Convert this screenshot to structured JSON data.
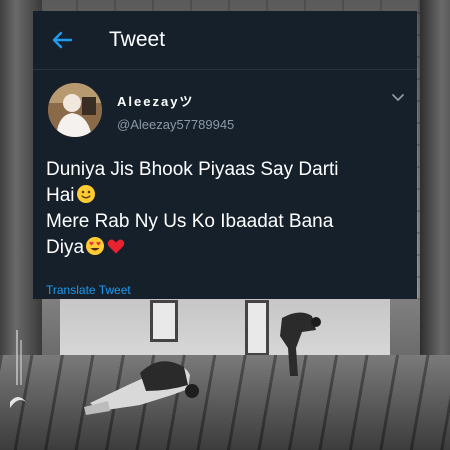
{
  "header": {
    "title": "Tweet"
  },
  "author": {
    "name": "Aleezayツ",
    "handle": "@Aleezay57789945"
  },
  "tweet": {
    "line1": "Duniya Jis Bhook Piyaas Say Darti",
    "line2": "Hai",
    "line3": "Mere Rab Ny Us Ko Ibaadat Bana",
    "line4": "Diya"
  },
  "actions": {
    "translate_label": "Translate Tweet"
  },
  "icons": {
    "back": "back-arrow-icon",
    "more": "chevron-down-icon",
    "emoji_smile": "slightly-smiling-face-icon",
    "emoji_hearts": "smiling-face-with-heart-eyes-icon",
    "emoji_heart": "red-heart-icon"
  },
  "colors": {
    "card_background": "#15202b",
    "accent": "#1d9bf0",
    "secondary_text": "#8b98a5"
  }
}
